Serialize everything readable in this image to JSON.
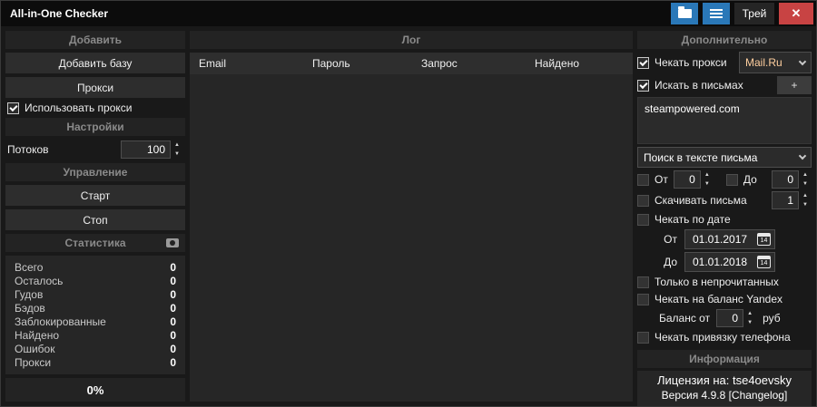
{
  "window": {
    "title": "All-in-One Checker",
    "tray_label": "Трей",
    "close_glyph": "✕"
  },
  "colors": {
    "accent_blue": "#2a78b8",
    "close_red": "#c84343",
    "proxy_value_text": "#ffcf9f",
    "panel_header_bg": "#232323",
    "panel_bg": "#262626"
  },
  "left_panel": {
    "add_header": "Добавить",
    "add_base_button": "Добавить базу",
    "proxy_button": "Прокси",
    "use_proxy_checkbox": "Использовать прокси",
    "settings_header": "Настройки",
    "threads_label": "Потоков",
    "threads_value": "100",
    "control_header": "Управление",
    "start_button": "Старт",
    "stop_button": "Стоп",
    "stats_header": "Статистика",
    "stats": [
      {
        "label": "Всего",
        "value": "0"
      },
      {
        "label": "Осталось",
        "value": "0"
      },
      {
        "label": "Гудов",
        "value": "0"
      },
      {
        "label": "Бэдов",
        "value": "0"
      },
      {
        "label": "Заблокированные",
        "value": "0"
      },
      {
        "label": "Найдено",
        "value": "0"
      },
      {
        "label": "Ошибок",
        "value": "0"
      },
      {
        "label": "Прокси",
        "value": "0"
      }
    ],
    "progress": "0%"
  },
  "log_panel": {
    "header": "Лог",
    "columns": [
      "Email",
      "Пароль",
      "Запрос",
      "Найдено"
    ],
    "rows": []
  },
  "right_panel": {
    "header": "Дополнительно",
    "check_proxy_label": "Чекать прокси",
    "proxy_service_value": "Mail.Ru",
    "search_in_letters_label": "Искать в письмах",
    "add_query_button": "+",
    "search_query_value": "steampowered.com",
    "search_mode_value": "Поиск в тексте письма",
    "from_label": "От",
    "from_value": "0",
    "to_label": "До",
    "to_value": "0",
    "download_letters_label": "Скачивать письма",
    "download_letters_value": "1",
    "check_by_date_label": "Чекать по дате",
    "date_from_label": "От",
    "date_from_value": "01.01.2017",
    "date_to_label": "До",
    "date_to_value": "01.01.2018",
    "calendar_day": "14",
    "only_unread_label": "Только в непрочитанных",
    "check_balance_label": "Чекать на баланс Yandex",
    "balance_from_label": "Баланс от",
    "balance_value": "0",
    "currency_label": "руб",
    "check_phone_label": "Чекать привязку телефона",
    "info_header": "Информация",
    "license_text": "Лицензия на: tse4oevsky",
    "version_text": "Версия 4.9.8 [Changelog]"
  }
}
